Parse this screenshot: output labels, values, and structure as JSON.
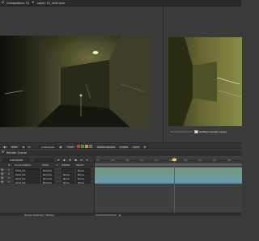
{
  "title_bar": {
    "tab_left_label": "Composition: 01_shot",
    "tab_right_label": "Layer: 01_shot.mov"
  },
  "viewer_right": {
    "layer_name_label": "Untitled (render_layer)"
  },
  "control_bar": {
    "zoom": "50%",
    "timecode": "0;00;00;00",
    "resolution": "Full",
    "view_menu": "Active Camera",
    "views_menu": "1 View",
    "offset": "+0.0"
  },
  "timeline": {
    "panel_tab_label": "Render Queue",
    "timecode": "0;00;00;00",
    "columns": [
      "#",
      "Source Name",
      "Mode",
      "T",
      "TrkMat",
      "Parent"
    ],
    "layers": [
      {
        "num": "1",
        "name": "Shot_01",
        "mode": "Normal",
        "trkmat": "",
        "parent": "None"
      },
      {
        "num": "2",
        "name": "Shot_02",
        "mode": "Normal",
        "trkmat": "None",
        "parent": "None"
      },
      {
        "num": "3",
        "name": "Shot_03",
        "mode": "Normal",
        "trkmat": "None",
        "parent": "None"
      },
      {
        "num": "4",
        "name": "Shot_04",
        "mode": "Normal",
        "trkmat": "None",
        "parent": "None"
      }
    ],
    "ruler_labels": [
      "0s",
      "01s",
      "02s",
      "03s",
      "04s",
      "05s",
      "06s",
      "07s",
      "08s",
      "09s"
    ],
    "playhead_time": "03s",
    "footer_label": "Toggle Switches / Modes"
  },
  "colors": {
    "track_green": "#6f9a86",
    "track_teal": "#6a9aa8",
    "playhead": "#c83030",
    "panel_bg": "#3a3a3a"
  }
}
